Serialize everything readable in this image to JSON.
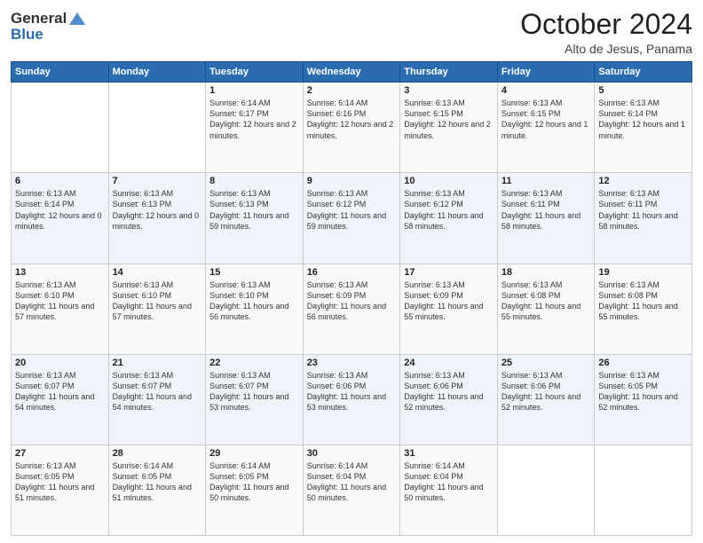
{
  "logo": {
    "general": "General",
    "blue": "Blue"
  },
  "header": {
    "month": "October 2024",
    "location": "Alto de Jesus, Panama"
  },
  "days_of_week": [
    "Sunday",
    "Monday",
    "Tuesday",
    "Wednesday",
    "Thursday",
    "Friday",
    "Saturday"
  ],
  "weeks": [
    [
      {
        "day": "",
        "sunrise": "",
        "sunset": "",
        "daylight": ""
      },
      {
        "day": "",
        "sunrise": "",
        "sunset": "",
        "daylight": ""
      },
      {
        "day": "1",
        "sunrise": "Sunrise: 6:14 AM",
        "sunset": "Sunset: 6:17 PM",
        "daylight": "Daylight: 12 hours and 2 minutes."
      },
      {
        "day": "2",
        "sunrise": "Sunrise: 6:14 AM",
        "sunset": "Sunset: 6:16 PM",
        "daylight": "Daylight: 12 hours and 2 minutes."
      },
      {
        "day": "3",
        "sunrise": "Sunrise: 6:13 AM",
        "sunset": "Sunset: 6:15 PM",
        "daylight": "Daylight: 12 hours and 2 minutes."
      },
      {
        "day": "4",
        "sunrise": "Sunrise: 6:13 AM",
        "sunset": "Sunset: 6:15 PM",
        "daylight": "Daylight: 12 hours and 1 minute."
      },
      {
        "day": "5",
        "sunrise": "Sunrise: 6:13 AM",
        "sunset": "Sunset: 6:14 PM",
        "daylight": "Daylight: 12 hours and 1 minute."
      }
    ],
    [
      {
        "day": "6",
        "sunrise": "Sunrise: 6:13 AM",
        "sunset": "Sunset: 6:14 PM",
        "daylight": "Daylight: 12 hours and 0 minutes."
      },
      {
        "day": "7",
        "sunrise": "Sunrise: 6:13 AM",
        "sunset": "Sunset: 6:13 PM",
        "daylight": "Daylight: 12 hours and 0 minutes."
      },
      {
        "day": "8",
        "sunrise": "Sunrise: 6:13 AM",
        "sunset": "Sunset: 6:13 PM",
        "daylight": "Daylight: 11 hours and 59 minutes."
      },
      {
        "day": "9",
        "sunrise": "Sunrise: 6:13 AM",
        "sunset": "Sunset: 6:12 PM",
        "daylight": "Daylight: 11 hours and 59 minutes."
      },
      {
        "day": "10",
        "sunrise": "Sunrise: 6:13 AM",
        "sunset": "Sunset: 6:12 PM",
        "daylight": "Daylight: 11 hours and 58 minutes."
      },
      {
        "day": "11",
        "sunrise": "Sunrise: 6:13 AM",
        "sunset": "Sunset: 6:11 PM",
        "daylight": "Daylight: 11 hours and 58 minutes."
      },
      {
        "day": "12",
        "sunrise": "Sunrise: 6:13 AM",
        "sunset": "Sunset: 6:11 PM",
        "daylight": "Daylight: 11 hours and 58 minutes."
      }
    ],
    [
      {
        "day": "13",
        "sunrise": "Sunrise: 6:13 AM",
        "sunset": "Sunset: 6:10 PM",
        "daylight": "Daylight: 11 hours and 57 minutes."
      },
      {
        "day": "14",
        "sunrise": "Sunrise: 6:13 AM",
        "sunset": "Sunset: 6:10 PM",
        "daylight": "Daylight: 11 hours and 57 minutes."
      },
      {
        "day": "15",
        "sunrise": "Sunrise: 6:13 AM",
        "sunset": "Sunset: 6:10 PM",
        "daylight": "Daylight: 11 hours and 56 minutes."
      },
      {
        "day": "16",
        "sunrise": "Sunrise: 6:13 AM",
        "sunset": "Sunset: 6:09 PM",
        "daylight": "Daylight: 11 hours and 56 minutes."
      },
      {
        "day": "17",
        "sunrise": "Sunrise: 6:13 AM",
        "sunset": "Sunset: 6:09 PM",
        "daylight": "Daylight: 11 hours and 55 minutes."
      },
      {
        "day": "18",
        "sunrise": "Sunrise: 6:13 AM",
        "sunset": "Sunset: 6:08 PM",
        "daylight": "Daylight: 11 hours and 55 minutes."
      },
      {
        "day": "19",
        "sunrise": "Sunrise: 6:13 AM",
        "sunset": "Sunset: 6:08 PM",
        "daylight": "Daylight: 11 hours and 55 minutes."
      }
    ],
    [
      {
        "day": "20",
        "sunrise": "Sunrise: 6:13 AM",
        "sunset": "Sunset: 6:07 PM",
        "daylight": "Daylight: 11 hours and 54 minutes."
      },
      {
        "day": "21",
        "sunrise": "Sunrise: 6:13 AM",
        "sunset": "Sunset: 6:07 PM",
        "daylight": "Daylight: 11 hours and 54 minutes."
      },
      {
        "day": "22",
        "sunrise": "Sunrise: 6:13 AM",
        "sunset": "Sunset: 6:07 PM",
        "daylight": "Daylight: 11 hours and 53 minutes."
      },
      {
        "day": "23",
        "sunrise": "Sunrise: 6:13 AM",
        "sunset": "Sunset: 6:06 PM",
        "daylight": "Daylight: 11 hours and 53 minutes."
      },
      {
        "day": "24",
        "sunrise": "Sunrise: 6:13 AM",
        "sunset": "Sunset: 6:06 PM",
        "daylight": "Daylight: 11 hours and 52 minutes."
      },
      {
        "day": "25",
        "sunrise": "Sunrise: 6:13 AM",
        "sunset": "Sunset: 6:06 PM",
        "daylight": "Daylight: 11 hours and 52 minutes."
      },
      {
        "day": "26",
        "sunrise": "Sunrise: 6:13 AM",
        "sunset": "Sunset: 6:05 PM",
        "daylight": "Daylight: 11 hours and 52 minutes."
      }
    ],
    [
      {
        "day": "27",
        "sunrise": "Sunrise: 6:13 AM",
        "sunset": "Sunset: 6:05 PM",
        "daylight": "Daylight: 11 hours and 51 minutes."
      },
      {
        "day": "28",
        "sunrise": "Sunrise: 6:14 AM",
        "sunset": "Sunset: 6:05 PM",
        "daylight": "Daylight: 11 hours and 51 minutes."
      },
      {
        "day": "29",
        "sunrise": "Sunrise: 6:14 AM",
        "sunset": "Sunset: 6:05 PM",
        "daylight": "Daylight: 11 hours and 50 minutes."
      },
      {
        "day": "30",
        "sunrise": "Sunrise: 6:14 AM",
        "sunset": "Sunset: 6:04 PM",
        "daylight": "Daylight: 11 hours and 50 minutes."
      },
      {
        "day": "31",
        "sunrise": "Sunrise: 6:14 AM",
        "sunset": "Sunset: 6:04 PM",
        "daylight": "Daylight: 11 hours and 50 minutes."
      },
      {
        "day": "",
        "sunrise": "",
        "sunset": "",
        "daylight": ""
      },
      {
        "day": "",
        "sunrise": "",
        "sunset": "",
        "daylight": ""
      }
    ]
  ]
}
